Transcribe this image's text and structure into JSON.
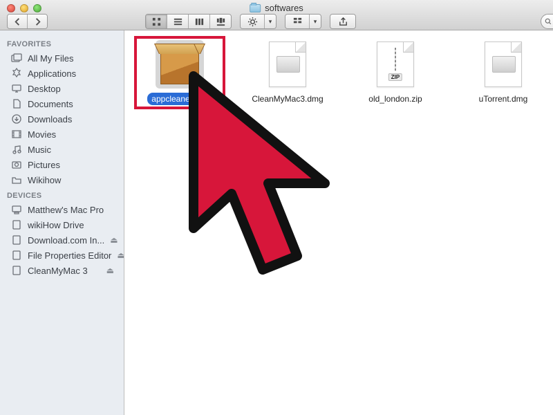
{
  "window": {
    "folder_name": "softwares"
  },
  "sidebar": {
    "favorites_label": "FAVORITES",
    "devices_label": "DEVICES",
    "favorites": [
      {
        "label": "All My Files",
        "icon": "all-files-icon"
      },
      {
        "label": "Applications",
        "icon": "applications-icon"
      },
      {
        "label": "Desktop",
        "icon": "desktop-icon"
      },
      {
        "label": "Documents",
        "icon": "documents-icon"
      },
      {
        "label": "Downloads",
        "icon": "downloads-icon"
      },
      {
        "label": "Movies",
        "icon": "movies-icon"
      },
      {
        "label": "Music",
        "icon": "music-icon"
      },
      {
        "label": "Pictures",
        "icon": "pictures-icon"
      },
      {
        "label": "Wikihow",
        "icon": "folder-icon"
      }
    ],
    "devices": [
      {
        "label": "Matthew's Mac Pro",
        "icon": "computer-icon",
        "ejectable": false
      },
      {
        "label": "wikiHow Drive",
        "icon": "disk-icon",
        "ejectable": false
      },
      {
        "label": "Download.com In...",
        "icon": "disk-icon",
        "ejectable": true
      },
      {
        "label": "File Properties Editor",
        "icon": "disk-icon",
        "ejectable": true
      },
      {
        "label": "CleanMyMac 3",
        "icon": "disk-icon",
        "ejectable": true
      }
    ]
  },
  "files": [
    {
      "name": "appcleaner.pkg",
      "type": "pkg",
      "selected": true,
      "highlighted": true
    },
    {
      "name": "CleanMyMac3.dmg",
      "type": "dmg",
      "selected": false
    },
    {
      "name": "old_london.zip",
      "type": "zip",
      "selected": false,
      "zip_badge": "ZIP"
    },
    {
      "name": "uTorrent.dmg",
      "type": "dmg",
      "selected": false
    }
  ],
  "colors": {
    "selection": "#2a6cd6",
    "highlight_ring": "#d7163a"
  }
}
